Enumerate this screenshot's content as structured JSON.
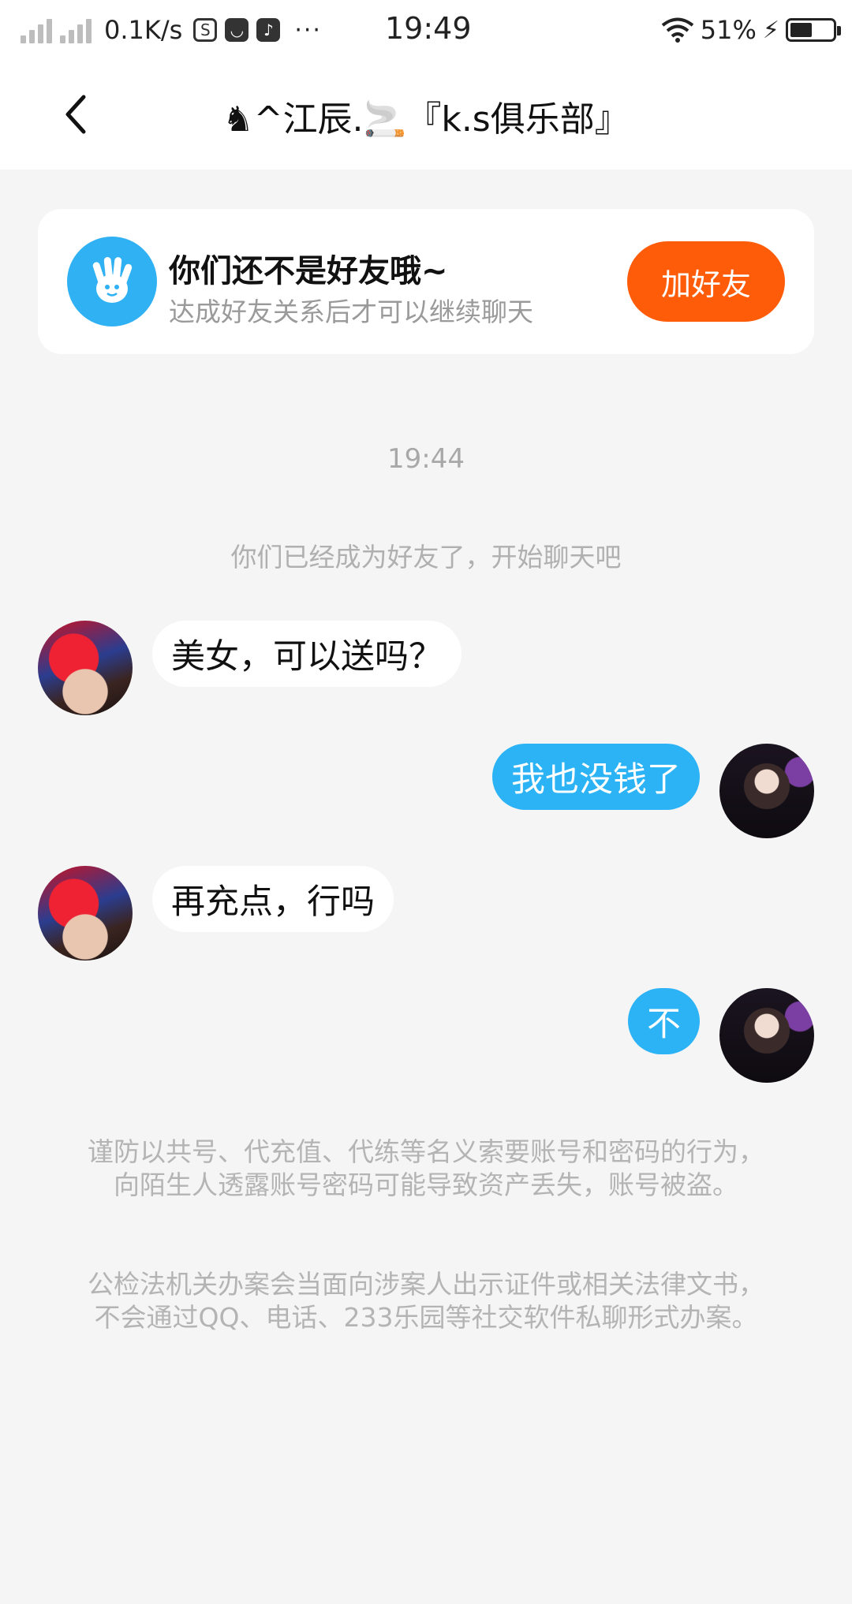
{
  "status_bar": {
    "net_speed": "0.1K/s",
    "time": "19:49",
    "more": "···",
    "battery_pct": "51%",
    "battery_level": 0.51
  },
  "header": {
    "title": "♞^江辰.🚬『k.s俱乐部』"
  },
  "notice": {
    "title": "你们还不是好友哦~",
    "subtitle": "达成好友关系后才可以继续聊天",
    "button": "加好友"
  },
  "chat": {
    "timestamp": "19:44",
    "system_message": "你们已经成为好友了，开始聊天吧",
    "messages": [
      {
        "from": "other",
        "text": "美女，可以送吗？"
      },
      {
        "from": "self",
        "text": "我也没钱了"
      },
      {
        "from": "other",
        "text": "再充点，行吗"
      },
      {
        "from": "self",
        "text": "不"
      }
    ]
  },
  "warnings": [
    "谨防以共号、代充值、代练等名义索要账号和密码的行为，向陌生人透露账号密码可能导致资产丢失，账号被盗。",
    "公检法机关办案会当面向涉案人出示证件或相关法律文书，不会通过QQ、电话、233乐园等社交软件私聊形式办案。"
  ]
}
